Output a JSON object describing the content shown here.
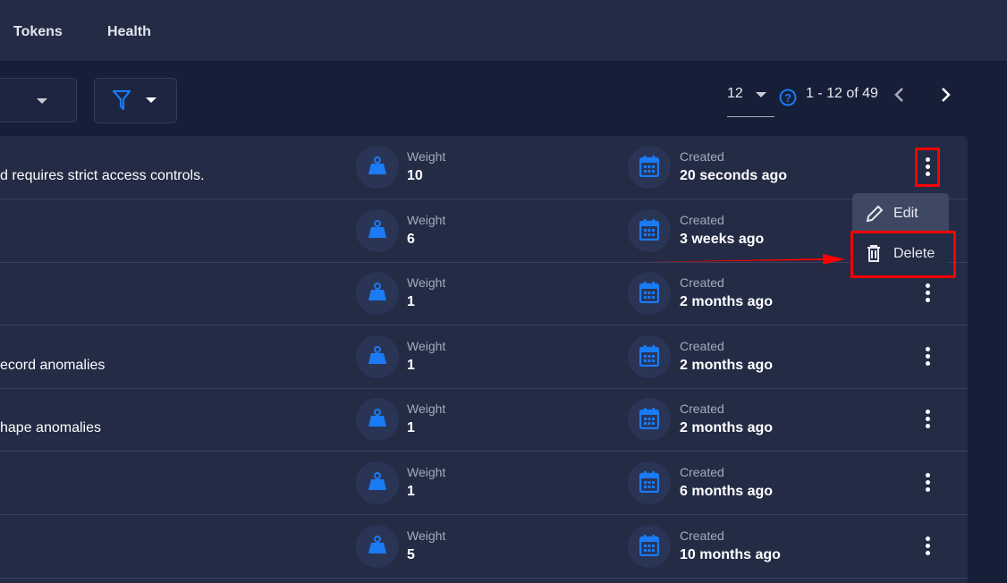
{
  "nav": {
    "tabs": [
      "Tokens",
      "Health"
    ]
  },
  "toolbar": {
    "page_size": "12",
    "range": "1 - 12 of 49"
  },
  "labels": {
    "weight": "Weight",
    "created": "Created"
  },
  "rows": [
    {
      "desc": "d requires strict access controls.",
      "weight": "10",
      "created": "20 seconds ago"
    },
    {
      "desc": "",
      "weight": "6",
      "created": "3 weeks ago"
    },
    {
      "desc": "",
      "weight": "1",
      "created": "2 months ago"
    },
    {
      "desc": "ecord anomalies",
      "weight": "1",
      "created": "2 months ago"
    },
    {
      "desc": "hape anomalies",
      "weight": "1",
      "created": "2 months ago"
    },
    {
      "desc": "",
      "weight": "1",
      "created": "6 months ago"
    },
    {
      "desc": "",
      "weight": "5",
      "created": "10 months ago"
    }
  ],
  "menu": {
    "edit": "Edit",
    "delete": "Delete"
  },
  "colors": {
    "accent": "#1a7bf5",
    "annotation": "#ff0000"
  }
}
